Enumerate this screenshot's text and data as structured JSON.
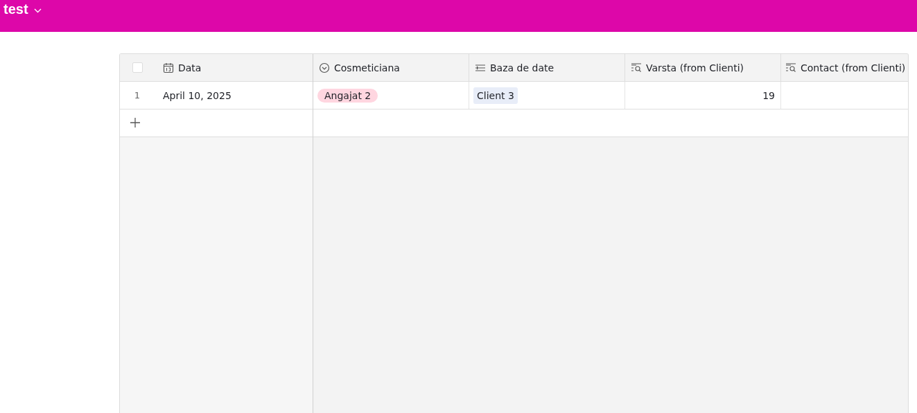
{
  "header": {
    "title": "test"
  },
  "table": {
    "select_all": {
      "checked": false
    },
    "columns": [
      {
        "label": "Data",
        "kind": "date"
      },
      {
        "label": "Cosmeticiana",
        "kind": "select"
      },
      {
        "label": "Baza de date",
        "kind": "link"
      },
      {
        "label": "Varsta (from Clienti)",
        "kind": "lookup"
      },
      {
        "label": "Contact (from Clienti)",
        "kind": "lookup"
      }
    ],
    "rows": [
      {
        "number": "1",
        "cells": [
          {
            "kind": "text",
            "value": "April 10, 2025"
          },
          {
            "kind": "pill",
            "value": "Angajat 2",
            "color": "#ffd6e0"
          },
          {
            "kind": "chip",
            "value": "Client 3"
          },
          {
            "kind": "number",
            "value": "19"
          },
          {
            "kind": "empty"
          }
        ]
      }
    ]
  }
}
